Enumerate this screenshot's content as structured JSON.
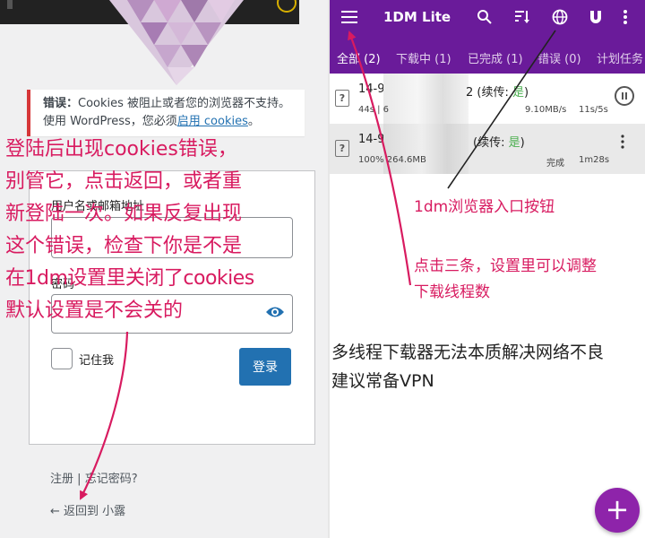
{
  "colors": {
    "annotation": "#d81b60",
    "app_bar": "#6a1b9a",
    "wp_button": "#2271b1",
    "error_border": "#d63638",
    "fab": "#8e24aa"
  },
  "login_page": {
    "error_title": "错误：",
    "error_line1": "Cookies 被阻止或者您的浏览器不支持。",
    "error_line2_prefix": "使用 WordPress，您必须",
    "error_link": "启用 cookies",
    "error_line2_suffix": "。",
    "username_label": "用户名或邮箱地址",
    "password_label": "密码",
    "remember_label": "记住我",
    "login_button": "登录",
    "register_link": "注册",
    "separator": "|",
    "lost_password_link": "忘记密码?",
    "back_link": "← 返回到 小露"
  },
  "annotation_left": [
    "登陆后出现cookies错误，",
    "别管它，点击返回，或者重",
    "新登陆一次。如果反复出现",
    "这个错误，检查下你是不是",
    "在1dm设置里关闭了cookies",
    "默认设置是不会关的"
  ],
  "app": {
    "title": "1DM Lite",
    "icons": [
      "menu-icon",
      "search-icon",
      "sort-icon",
      "browser-globe-icon",
      "magnet-icon",
      "more-vertical-icon"
    ],
    "tabs": [
      {
        "label": "全部 (2)",
        "active": true
      },
      {
        "label": "下载中 (1)",
        "active": false
      },
      {
        "label": "已完成 (1)",
        "active": false
      },
      {
        "label": "错误 (0)",
        "active": false
      },
      {
        "label": "计划任务",
        "active": false
      }
    ],
    "downloads": [
      {
        "name": "14-9-",
        "resume_prefix": "2 (续传: ",
        "resume_value": "是",
        "resume_suffix": ")",
        "progress": "44s | 6",
        "speed": "9.10MB/s",
        "time": "11s/5s",
        "status": ""
      },
      {
        "name": "14-9-",
        "resume_prefix": "(续传: ",
        "resume_value": "是",
        "resume_suffix": ")",
        "progress": "100% 264.6MB",
        "speed": "",
        "time": "1m28s",
        "status": "完成"
      }
    ],
    "fab_label": "+"
  },
  "annotations_right": {
    "browser_button": "1dm浏览器入口按钮",
    "menu_hint_1": "点击三条，设置里可以调整",
    "menu_hint_2": "下载线程数",
    "note_1": "多线程下载器无法本质解决网络不良",
    "note_2": "建议常备VPN"
  }
}
